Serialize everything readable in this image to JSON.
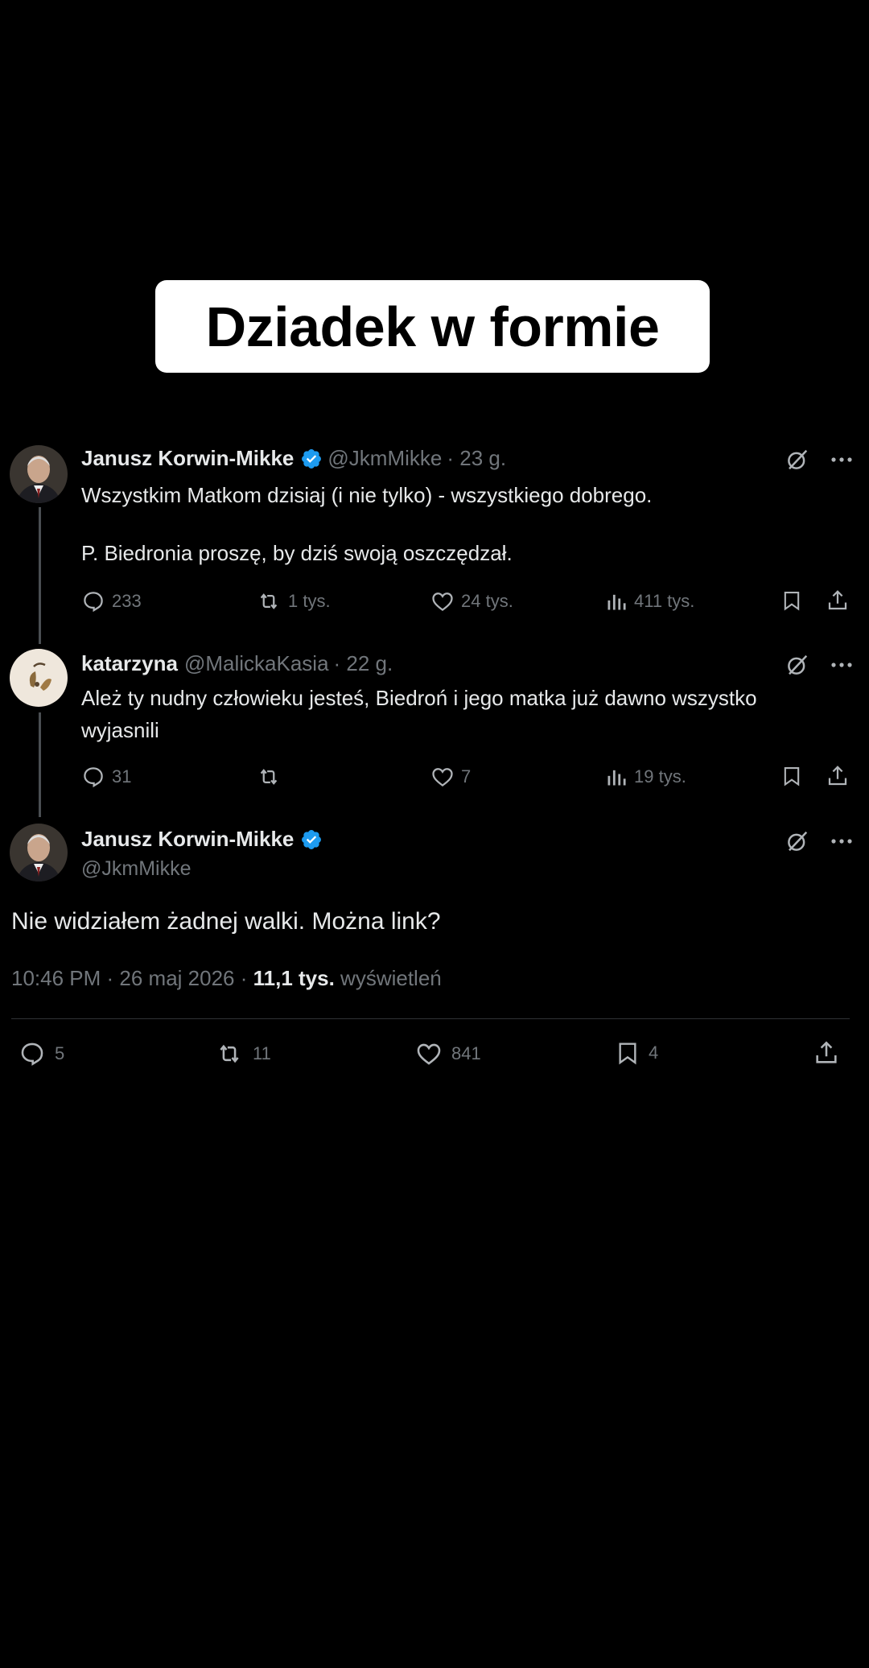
{
  "caption": "Dziadek w formie",
  "tweets": [
    {
      "name": "Janusz Korwin-Mikke",
      "handle": "@JkmMikke",
      "time": "· 23 g.",
      "lines": [
        "Wszystkim Matkom dzisiaj (i nie tylko) - wszystkiego dobrego.",
        "P. Biedronia proszę, by dziś swoją oszczędzał."
      ],
      "replies": "233",
      "reposts": "1 tys.",
      "likes": "24 tys.",
      "views": "411 tys."
    },
    {
      "name": "katarzyna",
      "handle": "@MalickaKasia",
      "time": "· 22 g.",
      "lines": [
        "Ależ ty nudny człowieku jesteś, Biedroń i jego matka już dawno wszystko",
        "wyjasnili"
      ],
      "replies": "31",
      "reposts": "",
      "likes": "7",
      "views": "19 tys."
    }
  ],
  "main": {
    "name": "Janusz Korwin-Mikke",
    "handle": "@JkmMikke",
    "text": "Nie widziałem żadnej walki. Można link?",
    "timestamp": "10:46 PM · 26 maj 2026 · ",
    "views_count": "11,1 tys.",
    "views_label": " wyświetleń",
    "replies": "5",
    "reposts": "11",
    "likes": "841",
    "bookmarks": "4"
  },
  "colors": {
    "background": "#000000",
    "text": "#e7e9ea",
    "muted": "#71767b",
    "verified": "#1d9bf0"
  },
  "icons": [
    "verified-icon",
    "grok-icon",
    "more-icon",
    "reply-icon",
    "repost-icon",
    "like-icon",
    "views-icon",
    "bookmark-icon",
    "share-icon"
  ]
}
